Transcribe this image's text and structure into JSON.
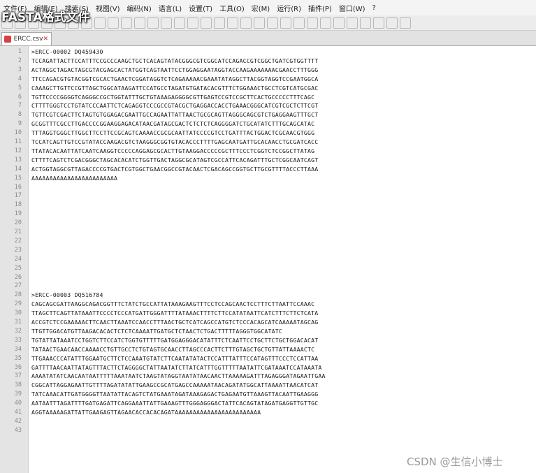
{
  "overlay_title": "FASTA格式文件",
  "menu": [
    "文件(F)",
    "编辑(E)",
    "搜索(S)",
    "视图(V)",
    "编码(N)",
    "语言(L)",
    "设置(T)",
    "工具(O)",
    "宏(M)",
    "运行(R)",
    "插件(P)",
    "窗口(W)",
    "?"
  ],
  "tab": {
    "label": "ERCC.csv",
    "close": "✕"
  },
  "watermark": "CSDN @生信小博士",
  "lines": [
    ">ERCC-00002 DQ459430",
    "TCCAGATTACTTCCATTTCCGCCCAAGCTGCTCACAGTATACGGGCGTCGGCATCCAGACCGTCGGCTGATCGTGGTTTT",
    "ACTAGGCTAGACTAGCGTACGAGCACTATGGTCAGTAATTCCTGGAGGAATAGGTACCAAGAAAAAAACGAACCTTTGGG",
    "TTCCAGACGTGTACGGTCGCACTGAACTCGGATAGGTCTCAGAAAAACGAAATATAGGCTTACGGTAGGTCCGAATGGCA",
    "CAAAGCTTGTTCCGTTAGCTGGCATAAGATTCCATGCCTAGATGTGATACACGTTTCTGGAAACTGCCTCGTCATGCGAC",
    "TGTTCCCCGGGGTCAGGGCCGCTGGTATTTGCTGTAAAGAGGGGCGTTGAGTCCGTCCGCTTCACTGCCCCCTTTCAGC",
    "CTTTTGGGTCCTGTATCCCAATTCTCAGAGGTCCCGCCGTACGCTGAGGACCACCTGAAACGGGCATCGTCGCTCTTCGT",
    "TGTTCGTCGACTTCTAGTGTGGAGACGAATTGCCAGAATTATTAACTGCGCAGTTAGGGCAGCGTCTGAGGAAGTTTGCT",
    "GCGGTTTCGCCTTGACCCCGGAAGGAGACATAACGATAGCGACTCTCTCTCAGGGGATCTGCATATCTTTGCAGCATAC",
    "TTTAGGTGGGCTTGGCTTCCTTCCGCAGTCAAAACCGCGCAATTATCCCCGTCCTGATTTACTGGACTCGCAACGTGGG",
    "TCCATCAGTTGTCCGTATACCAAGACGTCTAAGGGCGGTGTACACCCTTTTGAGCAATGATTGCACAACCTGCGATCACC",
    "TTATACACAATTATCAATCAAGGTCCCCCAGGAGCGCACTTGTAAGGACCCCCGCTTTCCCTCGGTCTCCGGCTTATAG",
    "CTTTTCAGTCTCGACGGGCTAGCACACATCTGGTTGACTAGGCGCATAGTCGCCATTCACAGATTTGCTCGGCAATCAGT",
    "ACTGGTAGGCGTTAGACCCCGTGACTCGTGGCTGAACGGCCGTACAACTCGACAGCCGGTGCTTGCGTTTTACCCTTAAA",
    "AAAAAAAAAAAAAAAAAAAAAAAA",
    "",
    "",
    "",
    "",
    "",
    "",
    "",
    "",
    "",
    "",
    "",
    "",
    ">ERCC-00003 DQ516784",
    "CAGCAGCGATTAAGGCAGACGGTTTCTATCTGCCATTATAAAGAAGTTTCCTCCAGCAACTCCTTTCTTAATTCCAAAC",
    "TTAGCTTCAGTTATAAATTCCCCTCCCATGATTGGGATTTTATAAACTTTTCTTCCATATAATTCATCTTTCTTCTCATA",
    "ACCGTCTCCGAAAAACTTCAACTTAAATCCAACCTTTAACTGCTCATCAGCCATGTCTCCCACAGCATCAAAAATAGCAG",
    "TTGTTGGACATGTTAAGACACACTCTCTCAAAATTGATGCTCTAACTCTGACTTTTTAGGGTGGCATATC",
    "TGTATTATAAATCCTGGTCTTCCATCTGGTGTTTTTGATGGAGGGACATATTTCTCAATTCCTGCTTCTGCTGGACACAT",
    "TATAACTGAACAACCAAAACCTGTTGCCTCTGTAGTGCAACCTTAGCCCACTTCTTTGTAGCTGCTGTTATTAAAACTC",
    "TTGAAACCCATATTTGGAATGCTTCTCCAAATGTATCTTCAATATATACTCCATTTATTTCCATAGTTTCCCTCCATTAA",
    "GATTTTAACAATTATAGTTTACTTCTAGGGGCTATTAATATCTTATCATTTGGTTTTTAATATTCGATAAATCCATAAATA",
    "AAAATATATCAACAATAATTTTTAAATAATCTAAGTATAGGTAATATAACAACTTAAAAAGATTTAGAGGGATAGAATTGAA",
    "CGGCATTAGGAGAATTGTTTTAGATATATTGAAGCCGCATGAGCCAAAAATAACAGATATGGCATTAAAATTAACATCAT",
    "TATCAAACATTGATGGGGTTAATATTACAGTCTATGAAATAGATAAAGAGACTGAGAATGTTAAAGTTACAATTGAAGGG",
    "AATAATTTAGATTTTGATGAGATTCAGGAAATTATTGAAAGTTTGGGAGGGACTATTCACAGTATAGATGAGGTTGTTGC",
    "AGGTAAAAAGATTATTGAAGAGTTAGAACACCACACAGATAAAAAAAAAAAAAAAAAAAAAAAA",
    "",
    ""
  ]
}
